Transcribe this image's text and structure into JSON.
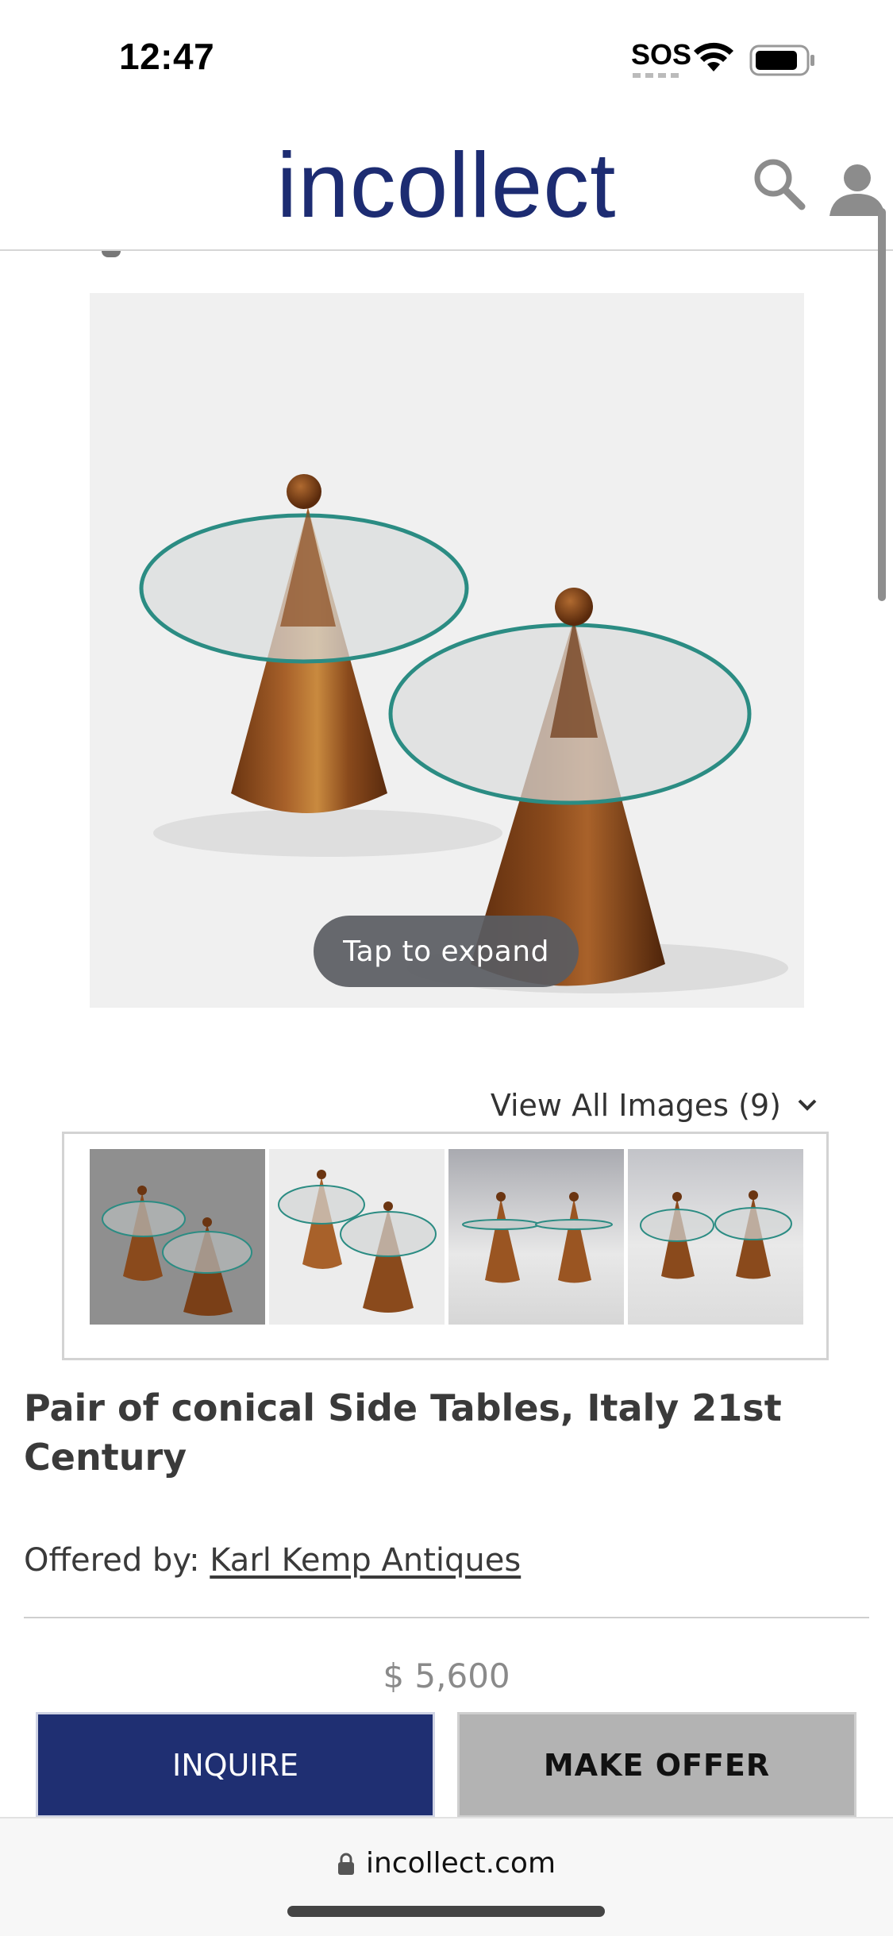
{
  "status": {
    "time": "12:47",
    "sos": "SOS"
  },
  "header": {
    "logo": "incollect"
  },
  "gallery": {
    "expand_label": "Tap to expand",
    "view_all_label": "View All Images (9)"
  },
  "product": {
    "title": "Pair of conical Side Tables, Italy 21st Century",
    "offered_label": "Offered by:",
    "dealer": "Karl Kemp Antiques",
    "price": "$ 5,600"
  },
  "actions": {
    "inquire": "INQUIRE",
    "offer": "MAKE OFFER"
  },
  "browser": {
    "url": "incollect.com"
  },
  "colors": {
    "brand": "#1f2f72",
    "offer_bg": "#b3b3b3",
    "wood": "#8a4a1c"
  },
  "icons": [
    "search-icon",
    "user-icon",
    "wifi-icon",
    "battery-icon",
    "chevron-down-icon",
    "lock-icon"
  ]
}
